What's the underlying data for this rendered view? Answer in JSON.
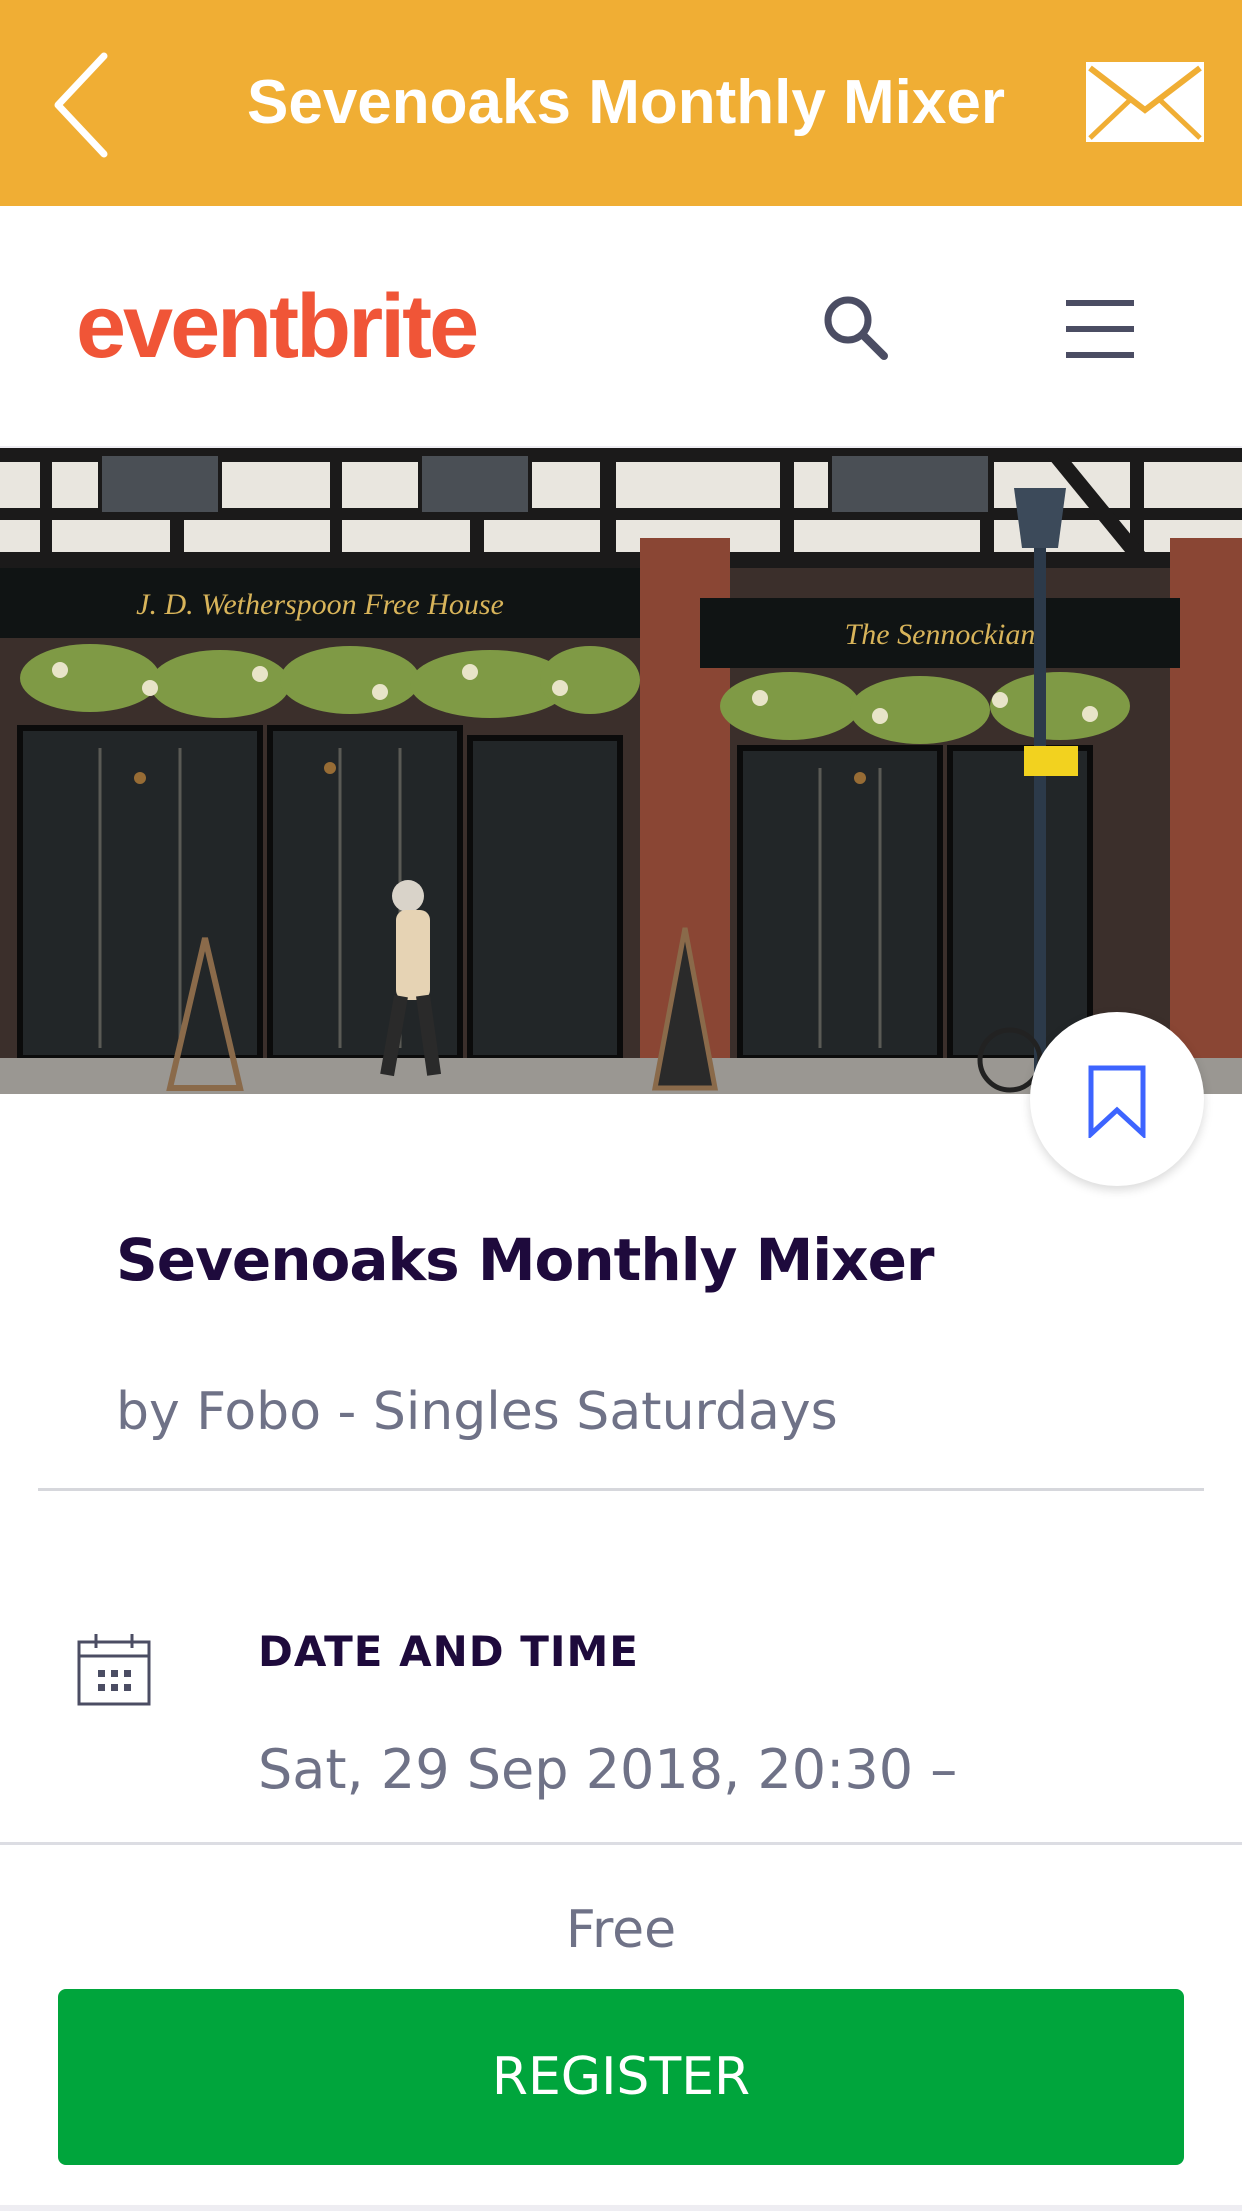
{
  "app_bar": {
    "title": "Sevenoaks Monthly Mixer",
    "background": "#f0ae34",
    "back_icon": "chevron-left-icon",
    "mail_icon": "envelope-icon"
  },
  "site_header": {
    "logo_text": "eventbrite",
    "logo_color": "#f05537",
    "search_icon": "search-icon",
    "menu_icon": "hamburger-menu-icon"
  },
  "hero": {
    "pub_sign_left": "J. D. Wetherspoon Free House",
    "pub_sign_right": "The Sennockian"
  },
  "event": {
    "title": "Sevenoaks Monthly Mixer",
    "organizer": "by Fobo - Singles Saturdays",
    "bookmark_icon": "bookmark-icon",
    "date_time_label": "DATE AND TIME",
    "date_time_value": "Sat, 29 Sep 2018, 20:30 –",
    "calendar_icon": "calendar-icon"
  },
  "footer": {
    "price": "Free",
    "register_label": "REGISTER",
    "register_color": "#00a53c"
  }
}
